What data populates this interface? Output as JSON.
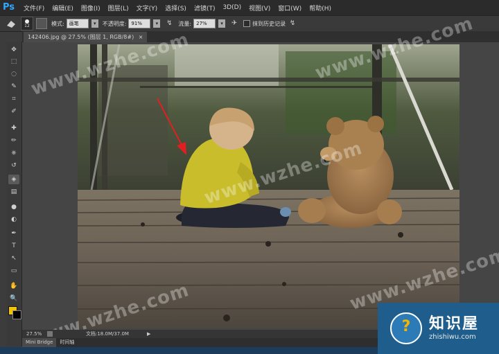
{
  "app": {
    "logo": "Ps"
  },
  "menubar": {
    "items": [
      "文件(F)",
      "编辑(E)",
      "图像(I)",
      "图层(L)",
      "文字(Y)",
      "选择(S)",
      "滤镜(T)",
      "3D(D)",
      "视图(V)",
      "窗口(W)",
      "帮助(H)"
    ]
  },
  "options": {
    "brush_size": "12",
    "mode_label": "模式:",
    "mode_value": "画笔",
    "opacity_label": "不透明度:",
    "opacity_value": "91%",
    "flow_label": "流量:",
    "flow_value": "27%",
    "erase_history_label": "抹到历史记录"
  },
  "document": {
    "tab_title": "142406.jpg @ 27.5% (图层 1, RGB/8#)",
    "tab_close": "×"
  },
  "status": {
    "zoom": "27.5%",
    "doc_info": "文档:18.0M/37.0M",
    "arrow": "▶"
  },
  "bottom_tabs": [
    "Mini Bridge",
    "时间轴"
  ],
  "watermark": "www.wzhe.com",
  "badge": {
    "title": "知识屋",
    "url": "zhishiwu.com",
    "icon_glyph": "?"
  },
  "colors": {
    "foreground": "#f2c300",
    "background": "#000000",
    "accent": "#31a8ff",
    "arrow": "#e02020"
  },
  "tools": [
    "move-tool",
    "marquee-tool",
    "lasso-tool",
    "quick-select-tool",
    "crop-tool",
    "eyedropper-tool",
    "healing-tool",
    "brush-tool",
    "clone-stamp-tool",
    "history-brush-tool",
    "eraser-tool",
    "gradient-tool",
    "blur-tool",
    "dodge-tool",
    "pen-tool",
    "type-tool",
    "path-select-tool",
    "shape-tool",
    "hand-tool",
    "zoom-tool"
  ],
  "tool_glyphs": [
    "✥",
    "⬚",
    "◌",
    "✎",
    "⌗",
    "✐",
    "✚",
    "✏",
    "⎈",
    "↺",
    "◈",
    "▤",
    "●",
    "◐",
    "✒",
    "T",
    "↖",
    "▭",
    "✋",
    "🔍"
  ]
}
